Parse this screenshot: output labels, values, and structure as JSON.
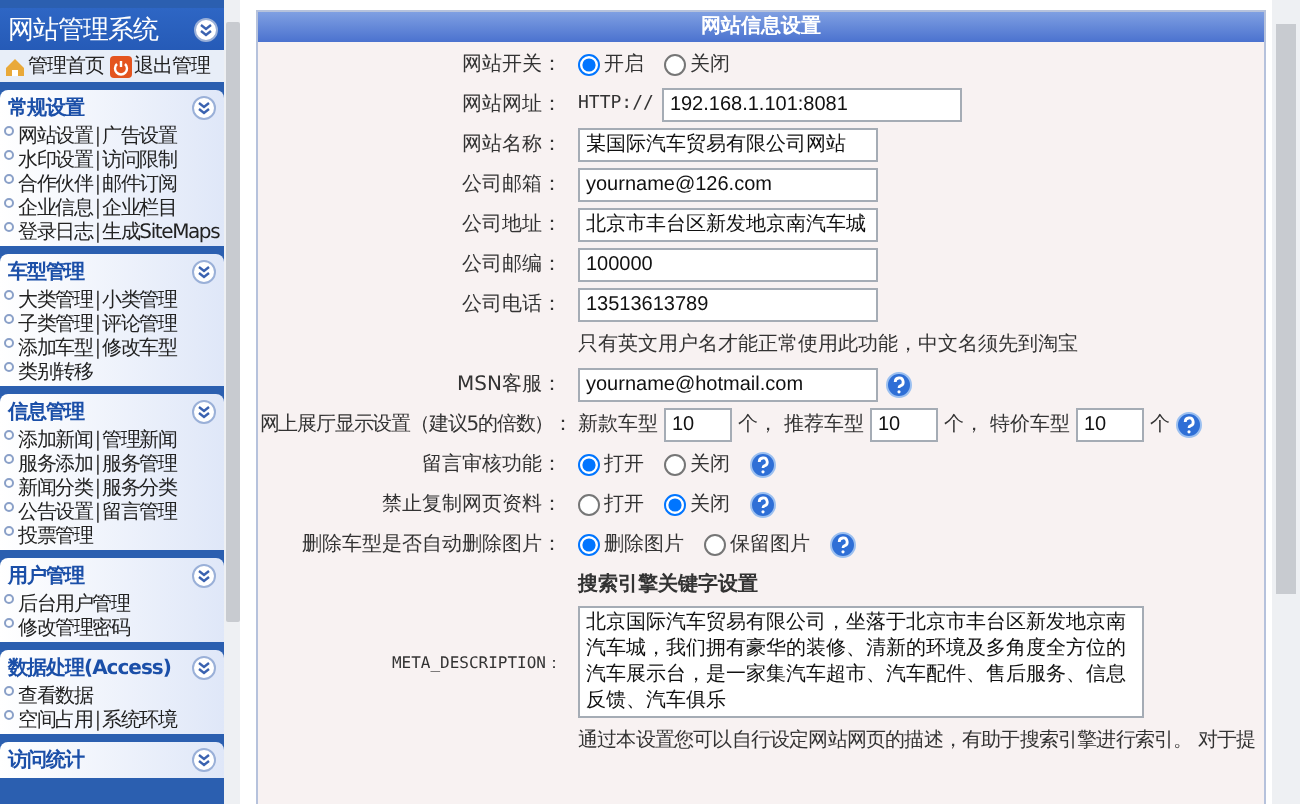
{
  "sidebar": {
    "title": "网站管理系统",
    "separator": "|",
    "top_links": [
      {
        "label": "管理首页",
        "kind": "home"
      },
      {
        "label": "退出管理",
        "kind": "logout"
      }
    ],
    "sections": [
      {
        "title": "常规设置",
        "rows": [
          [
            "网站设置",
            "广告设置"
          ],
          [
            "水印设置",
            "访问限制"
          ],
          [
            "合作伙伴",
            "邮件订阅"
          ],
          [
            "企业信息",
            "企业栏目"
          ],
          [
            "登录日志",
            "生成SiteMaps"
          ]
        ]
      },
      {
        "title": "车型管理",
        "rows": [
          [
            "大类管理",
            "小类管理"
          ],
          [
            "子类管理",
            "评论管理"
          ],
          [
            "添加车型",
            "修改车型"
          ],
          [
            "类别转移"
          ]
        ]
      },
      {
        "title": "信息管理",
        "rows": [
          [
            "添加新闻",
            "管理新闻"
          ],
          [
            "服务添加",
            "服务管理"
          ],
          [
            "新闻分类",
            "服务分类"
          ],
          [
            "公告设置",
            "留言管理"
          ],
          [
            "投票管理"
          ]
        ]
      },
      {
        "title": "用户管理",
        "rows": [
          [
            "后台用户管理"
          ],
          [
            "修改管理密码"
          ]
        ]
      },
      {
        "title": "数据处理(Access)",
        "rows": [
          [
            "查看数据"
          ],
          [
            "空间占用",
            "系统环境"
          ]
        ]
      },
      {
        "title": "访问统计"
      }
    ]
  },
  "main": {
    "title": "网站信息设置",
    "rows": [
      {
        "kind": "radio",
        "label": "网站开关：",
        "options": [
          {
            "label": "开启",
            "selected": true
          },
          {
            "label": "关闭",
            "selected": false
          }
        ]
      },
      {
        "kind": "text",
        "label": "网站网址：",
        "prefix": "HTTP://",
        "value": "192.168.1.101:8081"
      },
      {
        "kind": "text",
        "label": "网站名称：",
        "value": "某国际汽车贸易有限公司网站"
      },
      {
        "kind": "text",
        "label": "公司邮箱：",
        "value": "yourname@126.com"
      },
      {
        "kind": "text",
        "label": "公司地址：",
        "value": "北京市丰台区新发地京南汽车城"
      },
      {
        "kind": "text",
        "label": "公司邮编：",
        "value": "100000"
      },
      {
        "kind": "text",
        "label": "公司电话：",
        "value": "13513613789"
      },
      {
        "kind": "note",
        "text": "只有英文用户名才能正常使用此功能，中文名须先到淘宝"
      },
      {
        "kind": "text",
        "label": "MSN客服：",
        "value": "yourname@hotmail.com",
        "help": true
      },
      {
        "kind": "multi",
        "label": "网上展厅显示设置（建议5的倍数）：",
        "groups": [
          {
            "prefix": "新款车型",
            "value": "10",
            "suffix": "个，"
          },
          {
            "prefix": "推荐车型",
            "value": "10",
            "suffix": "个，"
          },
          {
            "prefix": "特价车型",
            "value": "10",
            "suffix": "个"
          }
        ],
        "help": true
      },
      {
        "kind": "radio",
        "label": "留言审核功能：",
        "options": [
          {
            "label": "打开",
            "selected": true
          },
          {
            "label": "关闭",
            "selected": false
          }
        ],
        "help": true
      },
      {
        "kind": "radio",
        "label": "禁止复制网页资料：",
        "options": [
          {
            "label": "打开",
            "selected": false
          },
          {
            "label": "关闭",
            "selected": true
          }
        ],
        "help": true
      },
      {
        "kind": "radio",
        "label": "删除车型是否自动删除图片：",
        "options": [
          {
            "label": "删除图片",
            "selected": true
          },
          {
            "label": "保留图片",
            "selected": false
          }
        ],
        "help": true
      },
      {
        "kind": "heading",
        "text": "搜索引擎关键字设置"
      },
      {
        "kind": "textarea",
        "label": "META_DESCRIPTION：",
        "value": "北京国际汽车贸易有限公司，坐落于北京市丰台区新发地京南汽车城，我们拥有豪华的装修、清新的环境及多角度全方位的汽车展示台，是一家集汽车超市、汽车配件、售后服务、信息反馈、汽车俱乐"
      },
      {
        "kind": "hint",
        "text": "通过本设置您可以自行设定网站网页的描述，有助于搜索引擎进行索引。 对于提"
      }
    ]
  }
}
